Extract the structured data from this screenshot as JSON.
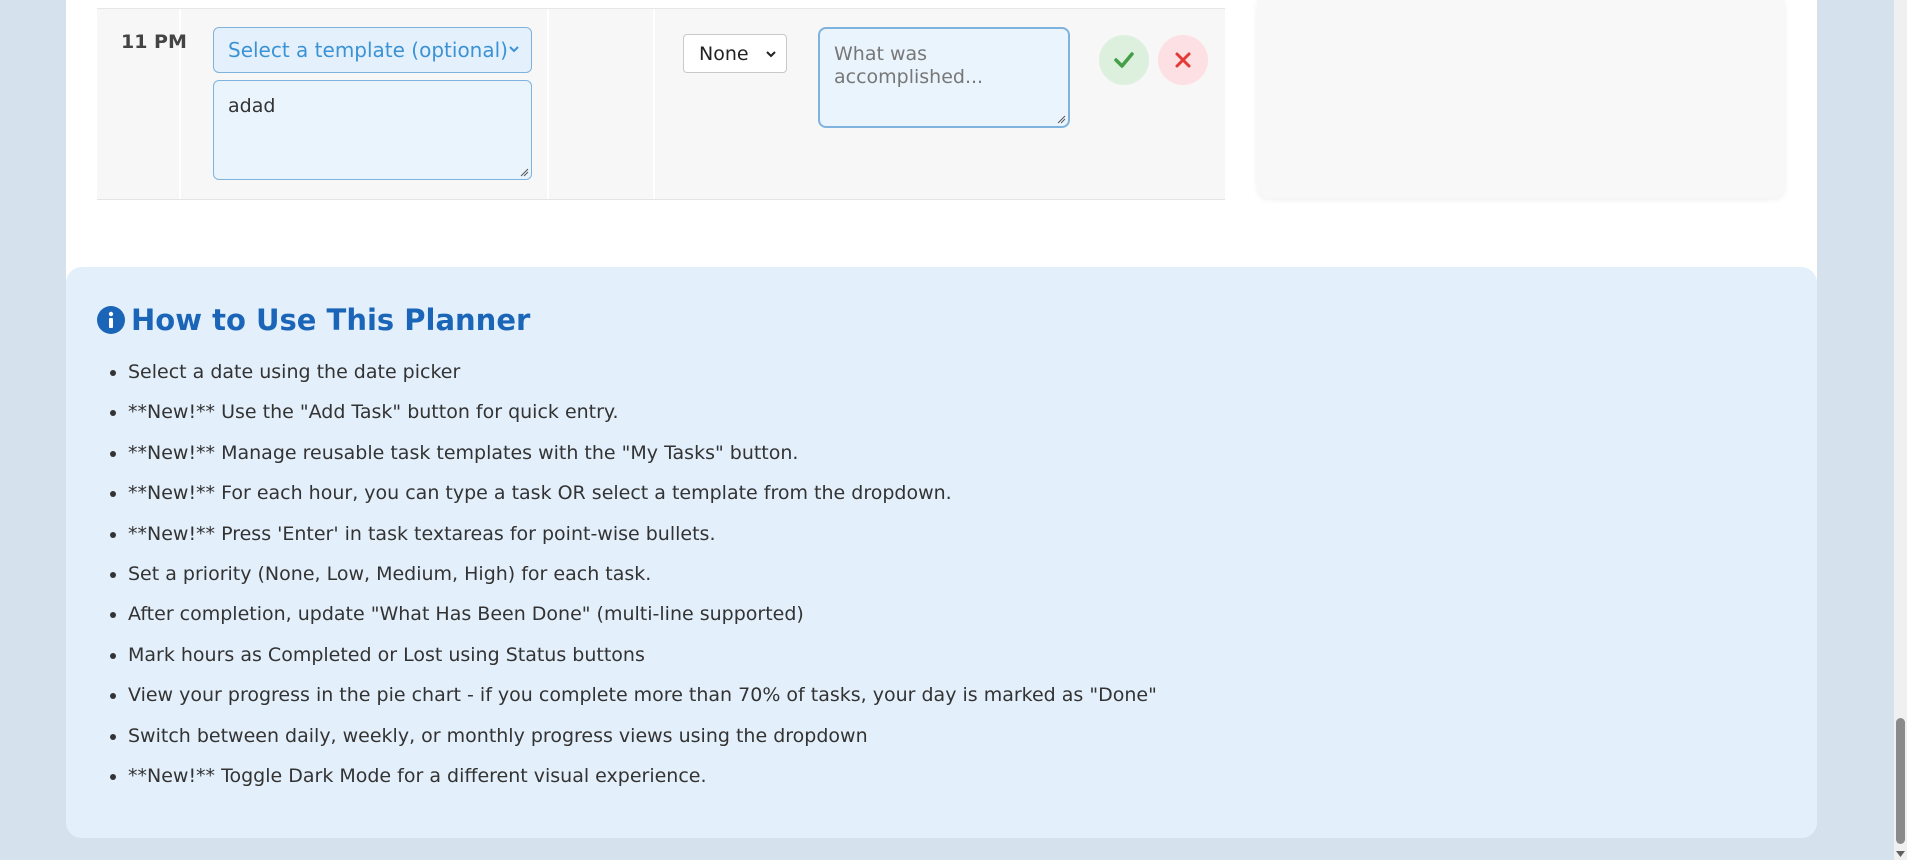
{
  "row": {
    "time": "11 PM",
    "template_select": {
      "value": "Select a template (optional)"
    },
    "task_text": "adad",
    "priority_select": {
      "value": "None"
    },
    "done_placeholder": "What was accomplished..."
  },
  "howto": {
    "title": "How to Use This Planner",
    "items": [
      "Select a date using the date picker",
      "**New!** Use the \"Add Task\" button for quick entry.",
      "**New!** Manage reusable task templates with the \"My Tasks\" button.",
      "**New!** For each hour, you can type a task OR select a template from the dropdown.",
      "**New!** Press 'Enter' in task textareas for point-wise bullets.",
      "Set a priority (None, Low, Medium, High) for each task.",
      "After completion, update \"What Has Been Done\" (multi-line supported)",
      "Mark hours as Completed or Lost using Status buttons",
      "View your progress in the pie chart - if you complete more than 70% of tasks, your day is marked as \"Done\"",
      "Switch between daily, weekly, or monthly progress views using the dropdown",
      "**New!** Toggle Dark Mode for a different visual experience."
    ]
  },
  "colors": {
    "accent": "#1a65b8",
    "complete": "#43a047",
    "lost": "#e53935",
    "panel_bg": "#e3effa"
  },
  "icons": {
    "complete": "check-icon",
    "lost": "close-icon",
    "info": "info-icon"
  }
}
